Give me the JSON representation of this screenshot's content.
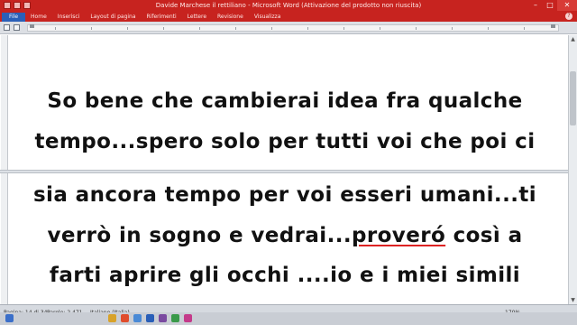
{
  "window": {
    "title": "Davide Marchese il rettiliano - Microsoft Word (Attivazione del prodotto non riuscita)"
  },
  "ribbon": {
    "tabs": [
      {
        "label": "File"
      },
      {
        "label": "Home"
      },
      {
        "label": "Inserisci"
      },
      {
        "label": "Layout di pagina"
      },
      {
        "label": "Riferimenti"
      },
      {
        "label": "Lettere"
      },
      {
        "label": "Revisione"
      },
      {
        "label": "Visualizza"
      }
    ]
  },
  "document": {
    "lines": [
      "So bene che cambierai idea fra qualche",
      "tempo...spero solo per tutti voi che poi ci",
      "sia ancora tempo per voi esseri umani...ti",
      "verrò in sogno e vedrai...",
      "farti aprire gli occhi ....io e i miei simili"
    ],
    "underlined_word": "proveró",
    "line4_rest": " così a"
  },
  "statusbar": {
    "page": "Pagina: 14 di 34",
    "words": "Parole: 2.471",
    "language": "Italiano (Italia)",
    "zoom": "170%"
  },
  "colors": {
    "titlebar": "#c7231f",
    "file_tab": "#2a5fb8",
    "text": "#111111",
    "spell_underline": "#dd2222"
  }
}
